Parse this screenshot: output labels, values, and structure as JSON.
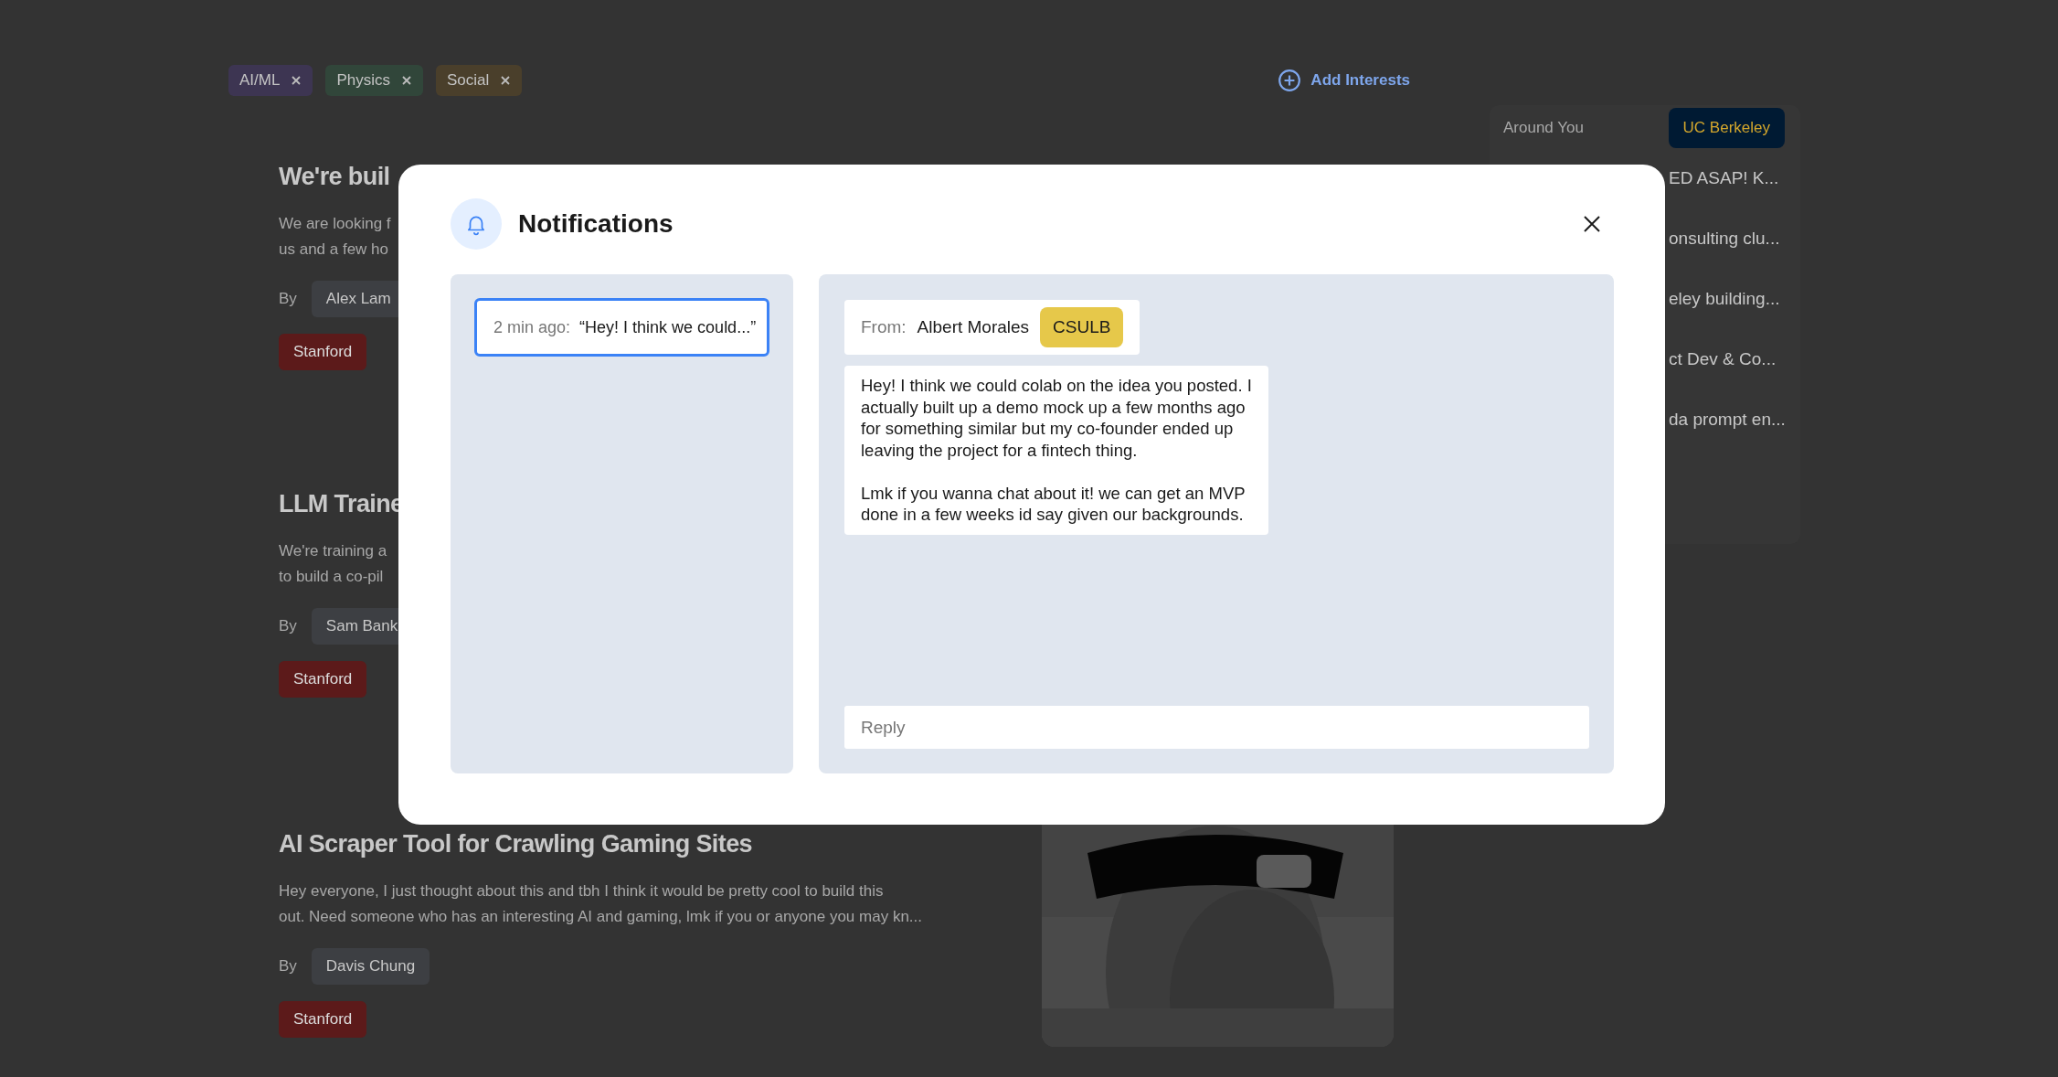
{
  "interests": [
    {
      "label": "AI/ML",
      "color": "#3d3552"
    },
    {
      "label": "Physics",
      "color": "#31463a"
    },
    {
      "label": "Social",
      "color": "#4a3f2b"
    }
  ],
  "add_interests": "Add Interests",
  "posts": [
    {
      "title": "We're buil",
      "description": [
        "We are looking f",
        "us and a few ho"
      ],
      "by": "By",
      "author": "Alex Lam",
      "tags": [
        {
          "label": "Stanford",
          "color": "#5c1a1a"
        }
      ]
    },
    {
      "title": "LLM Traine",
      "description": [
        "We're training a",
        "to build a co-pil"
      ],
      "by": "By",
      "author": "Sam Bank",
      "tags": [
        {
          "label": "Stanford",
          "color": "#5c1a1a"
        }
      ]
    },
    {
      "title": "AI Scraper Tool for Crawling Gaming Sites",
      "description": [
        "Hey everyone, I just thought about this and tbh I think it would be pretty cool to build this",
        "out. Need someone who has an interesting AI and gaming, lmk if you or anyone you may kn..."
      ],
      "by": "By",
      "author": "Davis Chung",
      "tags": [
        {
          "label": "Stanford",
          "color": "#5c1a1a"
        }
      ],
      "media": {
        "kind": "picture"
      }
    }
  ],
  "sidebar": {
    "heading": "Around You",
    "school": "UC Berkeley",
    "items": [
      "ED ASAP! K...",
      "onsulting clu...",
      "eley building...",
      "ct Dev & Co...",
      "da prompt en..."
    ]
  },
  "modal": {
    "title": "Notifications",
    "notifications": [
      {
        "time": "2 min ago:",
        "preview": "“Hey! I think we could...”",
        "selected": true
      }
    ],
    "message": {
      "from_label": "From:",
      "sender": "Albert Morales",
      "school": "CSULB",
      "paragraphs": [
        "Hey! I think we could colab on the idea you posted. I actually built up a demo mock up a few months ago for something similar but my co-founder ended up leaving the project for a fintech thing.",
        "Lmk if you wanna chat about it! we can get an MVP done in a few weeks id say given our backgrounds."
      ]
    },
    "reply": {
      "placeholder": "Reply"
    }
  }
}
